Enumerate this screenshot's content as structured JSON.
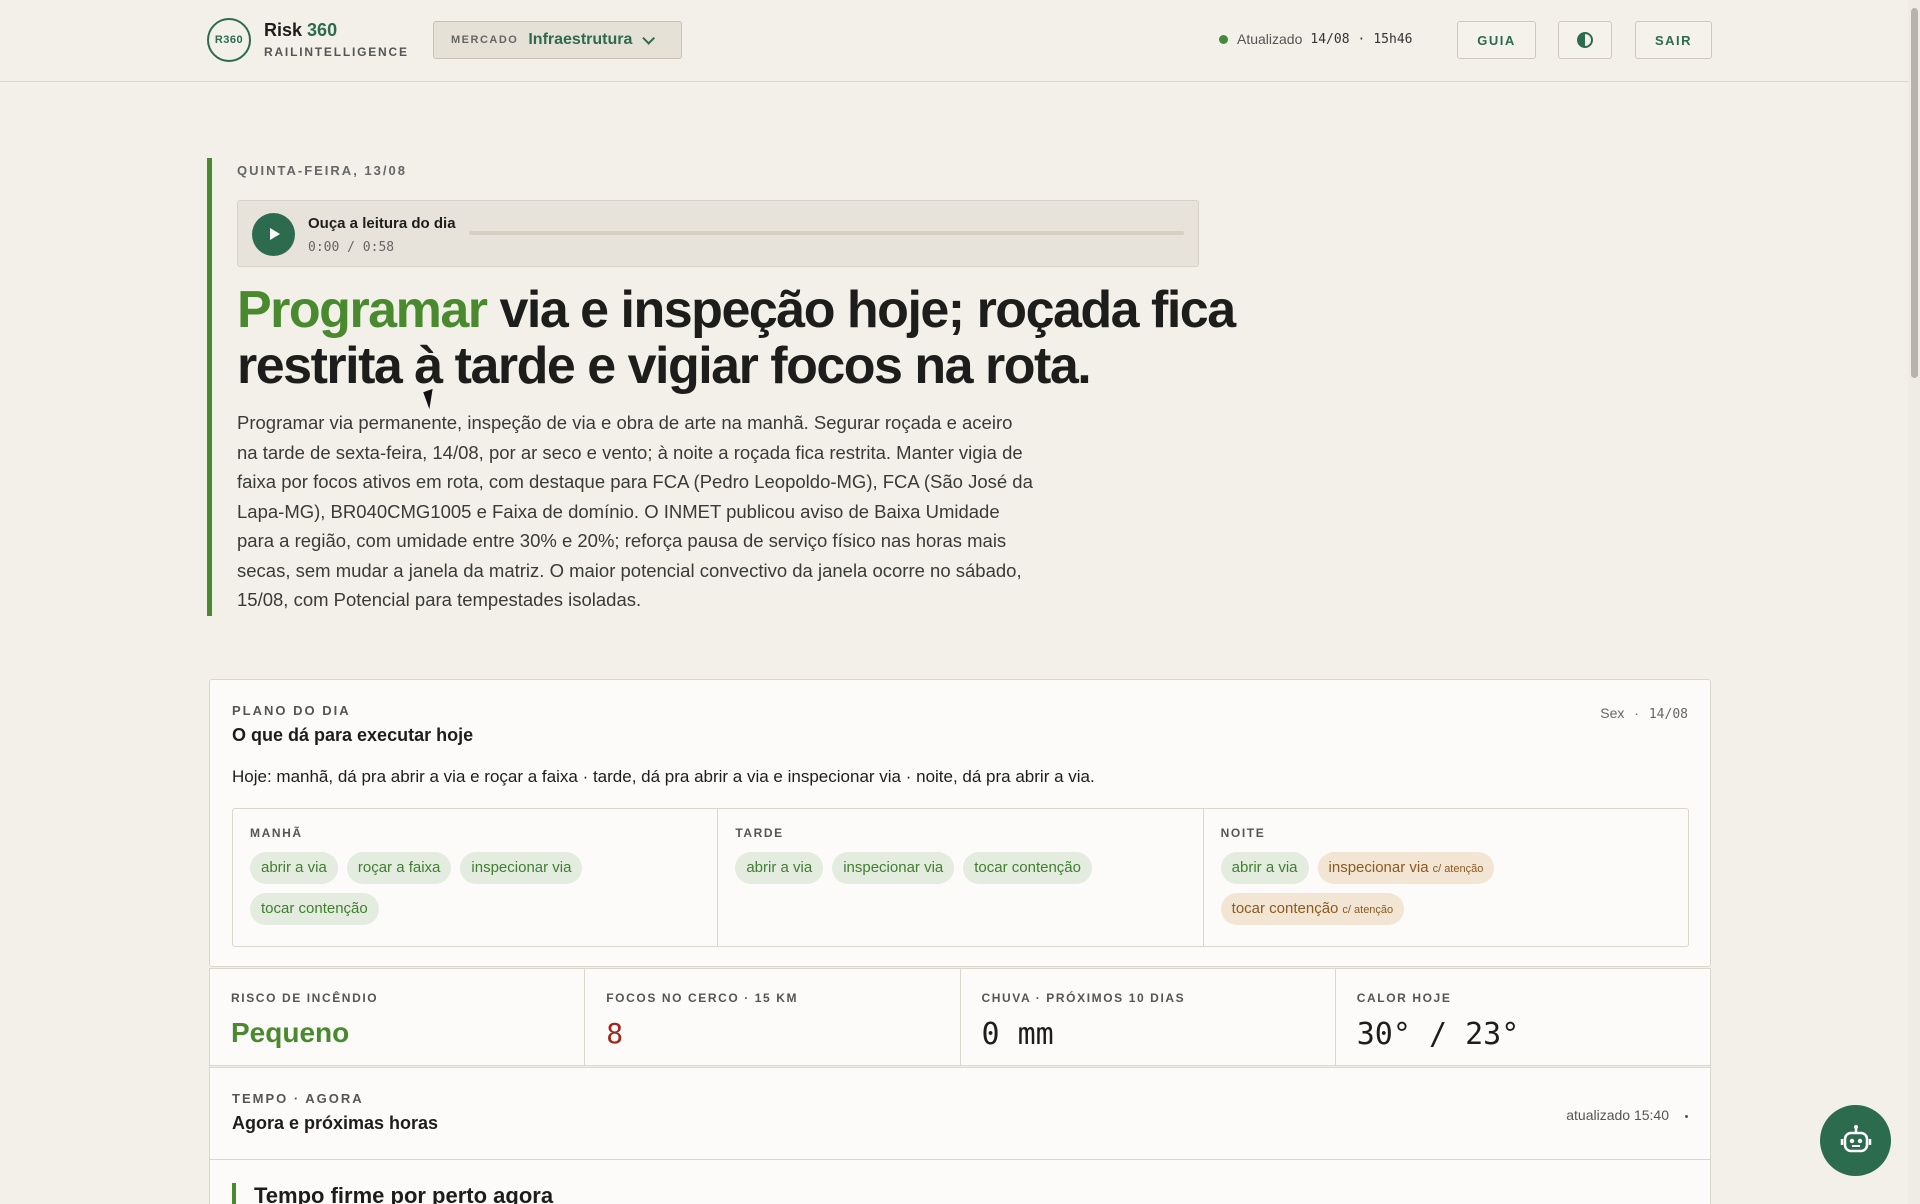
{
  "header": {
    "logo_text": "R360",
    "brand_name": "Risk",
    "brand_number": "360",
    "brand_sub": "RAILINTELLIGENCE",
    "market_label": "MERCADO",
    "market_value": "Infraestrutura",
    "status_label": "Atualizado",
    "status_date": "14/08",
    "status_sep": "·",
    "status_time": "15h46",
    "status_color": "#3f8a3c",
    "guide_label": "GUIA",
    "theme_icon": "contrast-icon",
    "logout_label": "SAIR"
  },
  "hero": {
    "date": "QUINTA-FEIRA, 13/08",
    "player": {
      "title": "Ouça a leitura do dia",
      "time": "0:00 / 0:58",
      "progress": 0
    },
    "headline_highlight": "Programar",
    "headline_rest": " via e inspeção hoje; roçada fica restrita à tarde e vigiar focos na rota.",
    "summary": "Programar via permanente, inspeção de via e obra de arte na manhã. Segurar roçada e aceiro na tarde de sexta-feira, 14/08, por ar seco e vento; à noite a roçada fica restrita. Manter vigia de faixa por focos ativos em rota, com destaque para FCA (Pedro Leopoldo-MG), FCA (São José da Lapa-MG), BR040CMG1005 e Faixa de domínio. O INMET publicou aviso de Baixa Umidade para a região, com umidade entre 30% e 20%; reforça pausa de serviço físico nas horas mais secas, sem mudar a janela da matriz. O maior potencial convectivo da janela ocorre no sábado, 15/08, com Potencial para tempestades isoladas."
  },
  "plan": {
    "overline": "PLANO DO DIA",
    "title": "O que dá para executar hoje",
    "day": "Sex",
    "sep": "·",
    "date": "14/08",
    "text": "Hoje: manhã, dá pra abrir a via e roçar a faixa · tarde, dá pra abrir a via e inspecionar via · noite, dá pra abrir a via.",
    "periods": [
      {
        "label": "MANHÃ",
        "tags": [
          "abrir a via",
          "roçar a faixa",
          "inspecionar via",
          "tocar contenção"
        ]
      },
      {
        "label": "TARDE",
        "tags": [
          "abrir a via",
          "inspecionar via",
          "tocar contenção"
        ]
      },
      {
        "label": "NOITE",
        "tags": [
          "abrir a via",
          "inspecionar via",
          "tocar contenção"
        ],
        "warn_note": "c/ atenção"
      }
    ]
  },
  "metrics": [
    {
      "label": "RISCO DE INCÊNDIO",
      "value": "Pequeno"
    },
    {
      "label": "FOCOS NO CERCO · 15 KM",
      "value": "8"
    },
    {
      "label": "CHUVA · PRÓXIMOS 10 DIAS",
      "value": "0 mm"
    },
    {
      "label": "CALOR HOJE",
      "value": "30° / 23°"
    }
  ],
  "weather": {
    "overline": "TEMPO · AGORA",
    "title": "Agora e próximas horas",
    "updated": "atualizado 15:40",
    "subtitle": "Tempo firme por perto agora"
  },
  "colors": {
    "accent_green": "#4a8a2f",
    "brand_green": "#2d6b4f",
    "alert_red": "#a3261c",
    "warn_tag_bg": "#f3e5d4"
  },
  "assistant": {
    "icon": "robot-icon"
  }
}
